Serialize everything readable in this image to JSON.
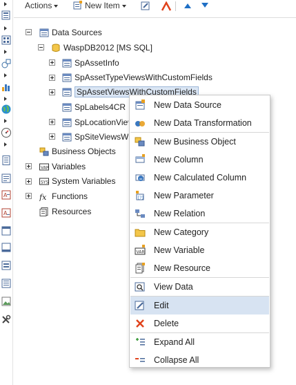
{
  "toolbar": {
    "actions_label": "Actions",
    "new_item_label": "New Item"
  },
  "tree": {
    "data_sources": "Data Sources",
    "connection": "WaspDB2012 [MS SQL]",
    "tables": [
      "SpAssetInfo",
      "SpAssetTypeViewsWithCustomFields",
      "SpAssetViewsWithCustomFields",
      "SpLabels4CR",
      "SpLocationView",
      "SpSiteViewsWi"
    ],
    "business_objects": "Business Objects",
    "variables": "Variables",
    "system_variables": "System Variables",
    "functions": "Functions",
    "resources": "Resources"
  },
  "context_menu": {
    "items": [
      "New Data Source",
      "New Data Transformation",
      "New Business Object",
      "New Column",
      "New Calculated Column",
      "New Parameter",
      "New Relation",
      "New Category",
      "New Variable",
      "New Resource",
      "View Data",
      "Edit",
      "Delete",
      "Expand All",
      "Collapse All"
    ],
    "highlighted": "Edit"
  },
  "colors": {
    "selection": "#dbe6f4",
    "menu_highlight": "#d7e3f2",
    "accent_blue": "#1f6fc5",
    "delete_red": "#e0421b"
  }
}
